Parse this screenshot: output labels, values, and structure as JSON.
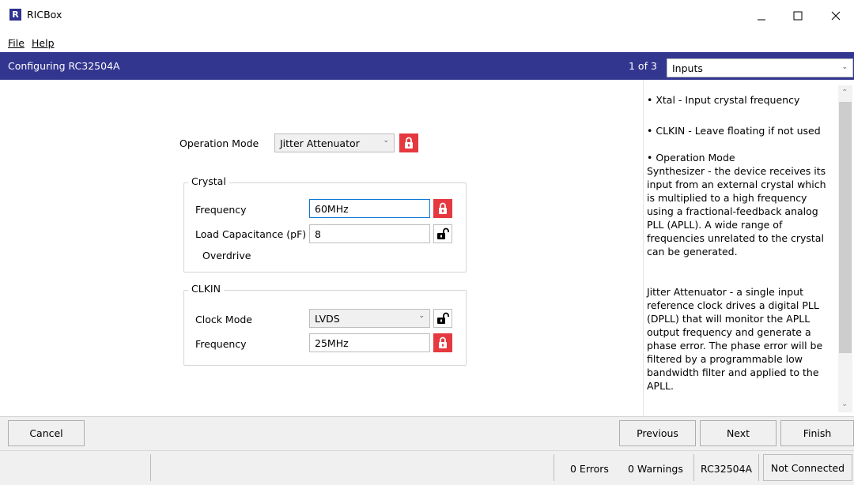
{
  "window": {
    "logo_text": "R",
    "title": "RICBox",
    "minimize_icon": "minimize-icon",
    "maximize_icon": "maximize-icon",
    "close_icon": "close-icon"
  },
  "menu": {
    "file_label": "File",
    "help_label": "Help"
  },
  "header": {
    "title": "Configuring RC32504A",
    "page_counter": "1 of 3",
    "page_select_value": "Inputs",
    "accent_color": "#33368f"
  },
  "form": {
    "operation_mode_label": "Operation Mode",
    "operation_mode_value": "Jitter Attenuator",
    "crystal": {
      "title": "Crystal",
      "frequency_label": "Frequency",
      "frequency_value": "60MHz",
      "load_cap_label": "Load Capacitance (pF)",
      "load_cap_value": "8",
      "overdrive_label": "Overdrive"
    },
    "clkin": {
      "title": "CLKIN",
      "clock_mode_label": "Clock Mode",
      "clock_mode_value": "LVDS",
      "frequency_label": "Frequency",
      "frequency_value": "25MHz"
    },
    "locked_color": "#e5383f"
  },
  "help": {
    "p1": "• Xtal - Input crystal frequency",
    "p2": "• CLKIN - Leave floating if not used",
    "p3": "• Operation Mode\n   Synthesizer - the device receives its\n   input from an external crystal which\n   is multiplied to a high frequency\n   using a fractional-feedback analog\n   PLL (APLL). A wide range of\n   frequencies unrelated to the crystal\n   can be generated.",
    "p4": "   Jitter Attenuator - a single input\n   reference clock drives a digital PLL\n   (DPLL) that will monitor the APLL\n   output frequency and generate a\n   phase error. The phase error will be\n   filtered by a programmable low\n   bandwidth filter and applied to the\n   APLL."
  },
  "buttons": {
    "cancel": "Cancel",
    "previous": "Previous",
    "next": "Next",
    "finish": "Finish"
  },
  "status": {
    "errors": "0 Errors",
    "warnings": "0 Warnings",
    "device": "RC32504A",
    "connection": "Not Connected"
  }
}
